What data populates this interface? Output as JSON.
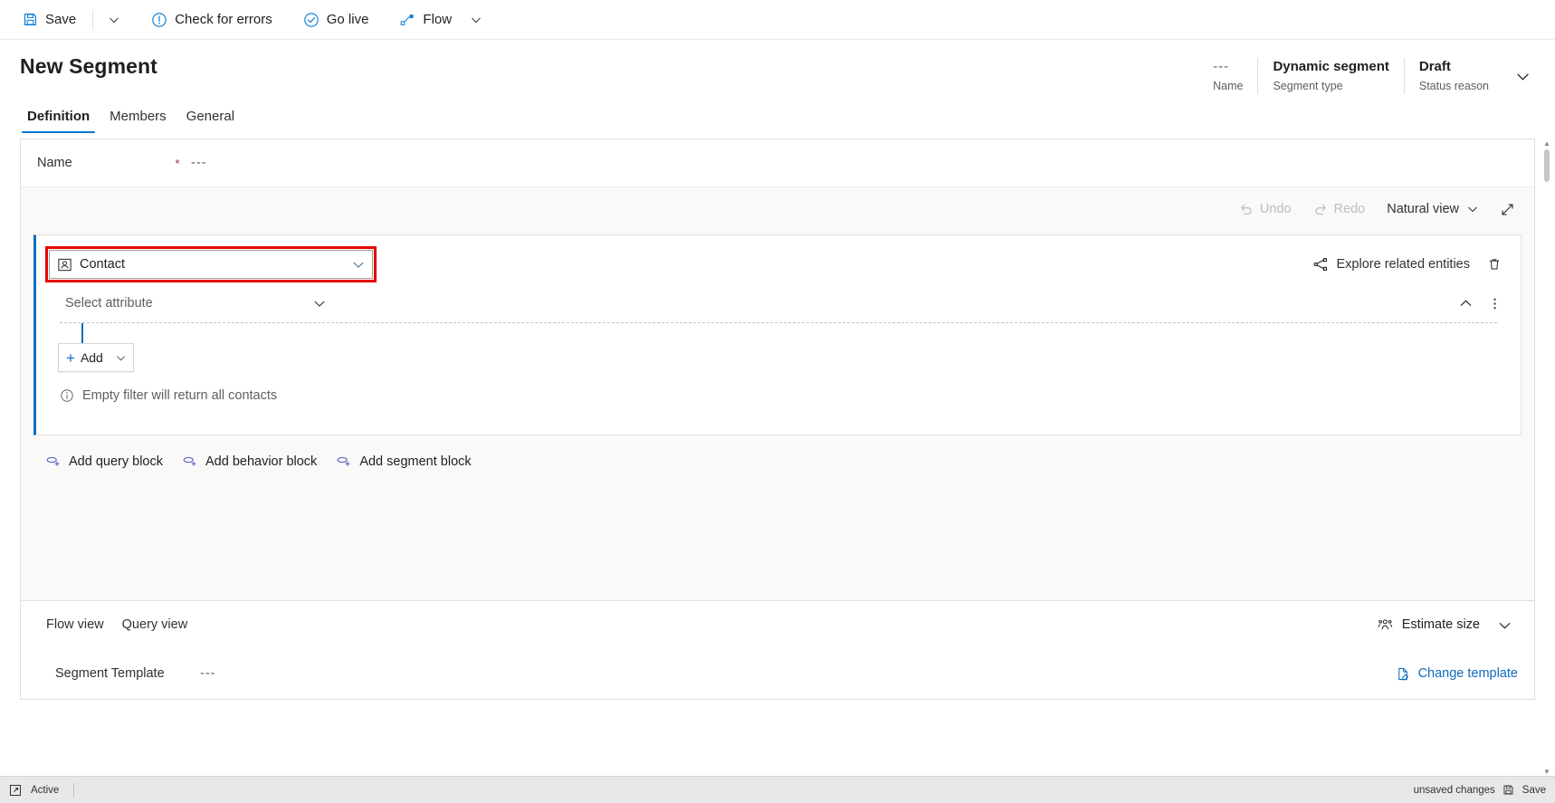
{
  "commandbar": {
    "save": {
      "label": "Save",
      "icon": "save-icon"
    },
    "save_caret": "chevron-down-icon",
    "check_errors": {
      "label": "Check for errors",
      "icon": "exclamation-circle-icon"
    },
    "go_live": {
      "label": "Go live",
      "icon": "check-circle-icon"
    },
    "flow": {
      "label": "Flow",
      "icon": "flow-icon"
    },
    "flow_caret": "chevron-down-icon"
  },
  "header": {
    "title": "New Segment",
    "fields": [
      {
        "value": "---",
        "label": "Name",
        "dim": true
      },
      {
        "value": "Dynamic segment",
        "label": "Segment type",
        "dim": false
      },
      {
        "value": "Draft",
        "label": "Status reason",
        "dim": false
      }
    ],
    "expand_icon": "chevron-down-icon"
  },
  "tabs": [
    {
      "label": "Definition",
      "active": true
    },
    {
      "label": "Members",
      "active": false
    },
    {
      "label": "General",
      "active": false
    }
  ],
  "form": {
    "name_row": {
      "label": "Name",
      "required_marker": "*",
      "value": "---"
    }
  },
  "canvas_toolbar": {
    "undo": {
      "label": "Undo",
      "icon": "undo-icon",
      "disabled": true
    },
    "redo": {
      "label": "Redo",
      "icon": "redo-icon",
      "disabled": true
    },
    "view_mode": {
      "label": "Natural view",
      "caret": "chevron-down-icon"
    },
    "expand": "expand-diagonal-icon"
  },
  "query_block": {
    "entity_select": {
      "value": "Contact",
      "icon": "contact-entity-icon",
      "caret": "chevron-down-icon",
      "highlighted": true,
      "highlight_color": "#e60000"
    },
    "explore_related": {
      "label": "Explore related entities",
      "icon": "share-nodes-icon"
    },
    "delete": "trash-icon",
    "attribute_select": {
      "placeholder": "Select attribute",
      "caret": "chevron-down-icon"
    },
    "collapse": "chevron-up-icon",
    "more": "more-vertical-icon",
    "add_button": {
      "label": "Add",
      "plus": "plus-icon",
      "caret": "chevron-down-icon"
    },
    "info_message": {
      "text": "Empty filter will return all contacts",
      "icon": "info-circle-icon"
    }
  },
  "block_actions": [
    {
      "label": "Add query block",
      "icon": "add-query-block-icon"
    },
    {
      "label": "Add behavior block",
      "icon": "add-behavior-block-icon"
    },
    {
      "label": "Add segment block",
      "icon": "add-segment-block-icon"
    }
  ],
  "footer": {
    "views": [
      {
        "label": "Flow view"
      },
      {
        "label": "Query view"
      }
    ],
    "estimate_size": {
      "label": "Estimate size",
      "icon": "people-icon",
      "caret": "chevron-down-icon"
    },
    "template_row": {
      "label": "Segment Template",
      "value": "---",
      "change_link": {
        "label": "Change template",
        "icon": "edit-page-icon"
      }
    }
  },
  "statusbar": {
    "left_icon": "open-record-icon",
    "state": "Active",
    "unsaved": "unsaved changes",
    "save": {
      "label": "Save",
      "icon": "save-icon"
    }
  },
  "colors": {
    "accent": "#0078d4",
    "block_accent": "#0f6cbd",
    "highlight": "#e60000",
    "link": "#0f6cbd",
    "purple_icon": "#5b5fc7"
  }
}
